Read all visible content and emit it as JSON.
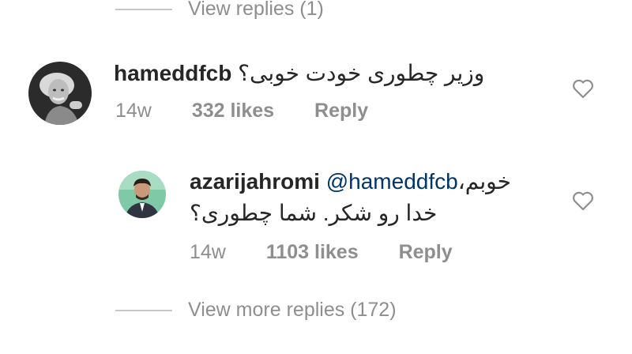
{
  "thread": {
    "top_view_replies": "View replies (1)",
    "bottom_view_more": "View more replies (172)"
  },
  "comment": {
    "username": "hameddfcb",
    "text": "وزیر چطوری خودت خوبی؟",
    "time": "14w",
    "likes": "332 likes",
    "reply": "Reply",
    "like_icon": "heart-outline-icon"
  },
  "reply": {
    "username": "azarijahromi",
    "mention": "@hameddfcb",
    "text_line1": "خوبم،",
    "text_line2": "خدا رو شکر. شما چطوری؟",
    "time": "14w",
    "likes": "1103 likes",
    "reply": "Reply",
    "like_icon": "heart-outline-icon"
  },
  "colors": {
    "text": "#262626",
    "muted": "#8e8e8e",
    "mention": "#003569",
    "divider": "#c7c7c7"
  }
}
